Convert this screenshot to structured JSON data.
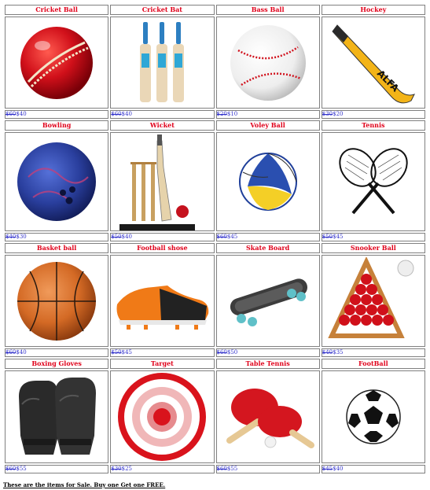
{
  "products": [
    {
      "name": "Cricket Ball",
      "old_price": "$60",
      "price": "$40",
      "icon": "cricket-ball-icon"
    },
    {
      "name": "Cricket Bat",
      "old_price": "$60",
      "price": "$40",
      "icon": "cricket-bat-icon"
    },
    {
      "name": "Bass Ball",
      "old_price": "$20",
      "price": "$10",
      "icon": "baseball-icon"
    },
    {
      "name": "Hockey",
      "old_price": "$30",
      "price": "$20",
      "icon": "hockey-stick-icon"
    },
    {
      "name": "Bowling",
      "old_price": "$40",
      "price": "$30",
      "icon": "bowling-ball-icon"
    },
    {
      "name": "Wicket",
      "old_price": "$50",
      "price": "$40",
      "icon": "wicket-icon"
    },
    {
      "name": "Voley Ball",
      "old_price": "$60",
      "price": "$45",
      "icon": "volleyball-icon"
    },
    {
      "name": "Tennis",
      "old_price": "$50",
      "price": "$45",
      "icon": "tennis-rackets-icon"
    },
    {
      "name": "Basket ball",
      "old_price": "$60",
      "price": "$40",
      "icon": "basketball-icon"
    },
    {
      "name": "Football shose",
      "old_price": "$50",
      "price": "$45",
      "icon": "football-shoe-icon"
    },
    {
      "name": "Skate Board",
      "old_price": "$60",
      "price": "$50",
      "icon": "skateboard-icon"
    },
    {
      "name": "Snooker Ball",
      "old_price": "$40",
      "price": "$35",
      "icon": "snooker-balls-icon"
    },
    {
      "name": "Boxing Gloves",
      "old_price": "$60",
      "price": "$55",
      "icon": "boxing-gloves-icon"
    },
    {
      "name": "Target",
      "old_price": "$30",
      "price": "$25",
      "icon": "target-icon"
    },
    {
      "name": "Table Tennis",
      "old_price": "$60",
      "price": "$55",
      "icon": "table-tennis-icon"
    },
    {
      "name": "FootBall",
      "old_price": "$45",
      "price": "$40",
      "icon": "football-icon"
    }
  ],
  "footer_text": "These are the items for Sale. Buy one Get one FREE."
}
